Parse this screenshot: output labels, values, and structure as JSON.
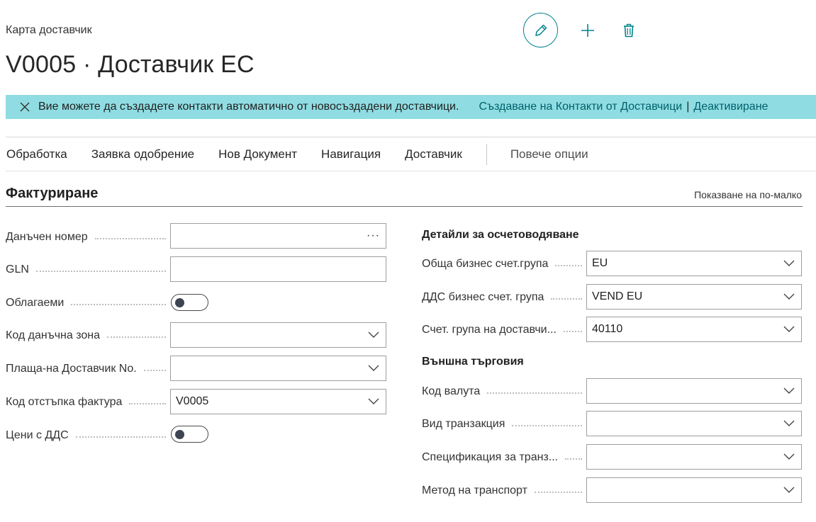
{
  "header": {
    "breadcrumb": "Карта доставчик",
    "title": "V0005 · Доставчик ЕС"
  },
  "banner": {
    "message": "Вие можете да създадете контакти автоматично от новосъздадени доставчици.",
    "link_create": "Създаване на Контакти от Доставчици",
    "separator": "|",
    "link_deactivate": "Деактивиране"
  },
  "menu": {
    "items": [
      "Обработка",
      "Заявка одобрение",
      "Нов Документ",
      "Навигация",
      "Доставчик"
    ],
    "more": "Повече опции"
  },
  "section": {
    "title": "Фактуриране",
    "show_less": "Показване на по-малко"
  },
  "left_fields": {
    "vat_number": {
      "label": "Данъчен номер",
      "value": "",
      "ellipsis": "···"
    },
    "gln": {
      "label": "GLN",
      "value": ""
    },
    "taxable": {
      "label": "Облагаеми",
      "checked": false
    },
    "tax_area_code": {
      "label": "Код данъчна зона",
      "value": ""
    },
    "pay_to_vendor": {
      "label": "Плаща-на Доставчик No.",
      "value": ""
    },
    "invoice_disc_code": {
      "label": "Код отстъпка фактура",
      "value": "V0005"
    },
    "prices_incl_vat": {
      "label": "Цени с ДДС",
      "checked": false
    }
  },
  "posting": {
    "heading": "Детайли за осчетоводяване",
    "gen_bus_posting_group": {
      "label": "Обща бизнес счет.група",
      "value": "EU"
    },
    "vat_bus_posting_group": {
      "label": "ДДС бизнес счет. група",
      "value": "VEND EU"
    },
    "vendor_posting_group": {
      "label": "Счет. група на доставчи...",
      "value": "40110"
    }
  },
  "foreign_trade": {
    "heading": "Външна търговия",
    "currency_code": {
      "label": "Код валута",
      "value": ""
    },
    "transaction_type": {
      "label": "Вид транзакция",
      "value": ""
    },
    "transaction_spec": {
      "label": "Спецификация за транз...",
      "value": ""
    },
    "transport_method": {
      "label": "Метод на транспорт",
      "value": ""
    }
  },
  "colors": {
    "accent": "#00838f",
    "banner_bg": "#8fdde2",
    "link": "#00606b"
  },
  "icons": {
    "edit": "pencil-icon",
    "new": "plus-icon",
    "delete": "trash-icon",
    "dismiss": "close-icon",
    "dropdown": "chevron-down-icon"
  }
}
